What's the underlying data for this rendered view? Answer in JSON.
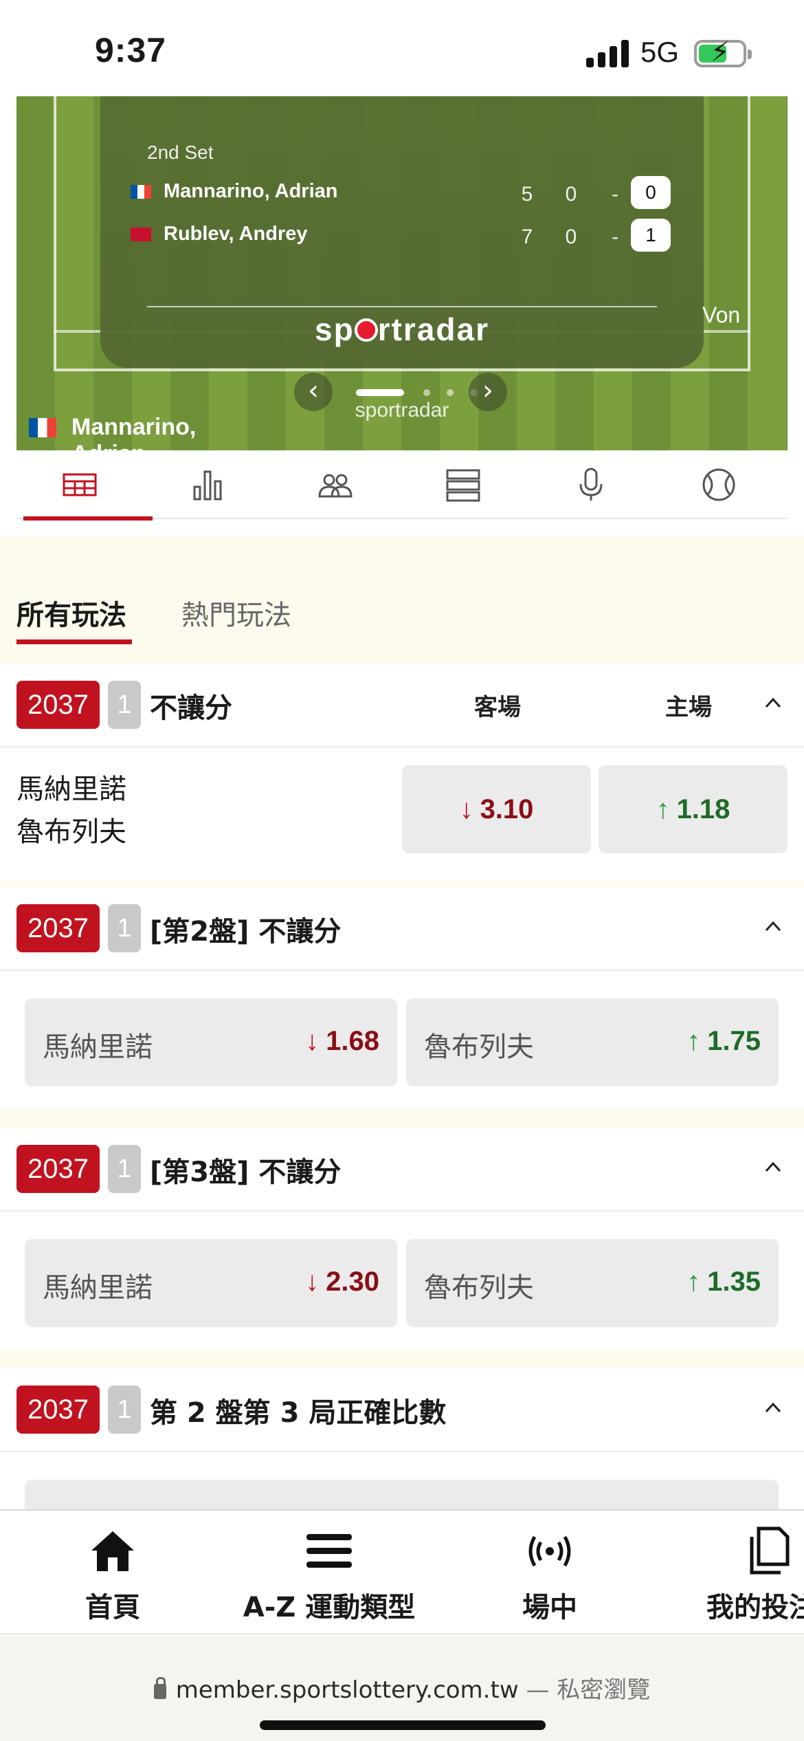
{
  "status_bar": {
    "time": "9:37",
    "network": "5G",
    "battery_icon": "battery-charging-icon",
    "signal_icon": "signal-bars-icon"
  },
  "widget": {
    "set_label": "2nd Set",
    "players": [
      {
        "name": "Mannarino, Adrian",
        "flag": "france-flag-icon",
        "games": "5",
        "col2": "0",
        "col3": "-",
        "points": "0"
      },
      {
        "name": "Rublev, Andrey",
        "flag": "russia-flag-icon",
        "games": "7",
        "col2": "0",
        "col3": "-",
        "points": "1"
      }
    ],
    "logo_prefix": "sp",
    "logo_suffix": "rtradar",
    "won_text": "Von",
    "pager": {
      "total": 4,
      "active": 1
    },
    "footer_player": "Mannarino, Adrian"
  },
  "icon_tabs": [
    {
      "name": "court-icon",
      "active": true
    },
    {
      "name": "stats-bars-icon",
      "active": false
    },
    {
      "name": "head-to-head-icon",
      "active": false
    },
    {
      "name": "list-icon",
      "active": false
    },
    {
      "name": "microphone-icon",
      "active": false
    },
    {
      "name": "tennis-ball-icon",
      "active": false
    }
  ],
  "market_tabs": {
    "all": "所有玩法",
    "hot": "熱門玩法"
  },
  "sections": [
    {
      "code": "2037",
      "num": "1",
      "title": "不讓分",
      "col_away": "客場",
      "col_home": "主場",
      "team_away": "馬納里諾",
      "team_home": "魯布列夫",
      "odd_away": "3.10",
      "odd_home": "1.18",
      "odd_away_arrow": "↓",
      "odd_home_arrow": "↑"
    },
    {
      "code": "2037",
      "num": "1",
      "title": "[第2盤] 不讓分",
      "left_label": "馬納里諾",
      "left_odd": "1.68",
      "left_arrow": "↓",
      "right_label": "魯布列夫",
      "right_odd": "1.75",
      "right_arrow": "↑"
    },
    {
      "code": "2037",
      "num": "1",
      "title": "[第3盤] 不讓分",
      "left_label": "馬納里諾",
      "left_odd": "2.30",
      "left_arrow": "↓",
      "right_label": "魯布列夫",
      "right_odd": "1.35",
      "right_arrow": "↑"
    },
    {
      "code": "2037",
      "num": "1",
      "title": "第 2 盤第 3 局正確比數"
    }
  ],
  "bottom_nav": [
    {
      "label": "首頁",
      "icon": "home-icon"
    },
    {
      "label": "A-Z 運動類型",
      "icon": "menu-icon"
    },
    {
      "label": "場中",
      "icon": "live-broadcast-icon"
    },
    {
      "label": "我的投注",
      "icon": "my-bets-icon"
    }
  ],
  "browser": {
    "url": "member.sportslottery.com.tw",
    "mode": " — 私密瀏覽"
  },
  "colors": {
    "brand_red": "#c1121f",
    "odds_down": "#8b0d16",
    "odds_up": "#1d6b27",
    "court_green": "#7da03f"
  }
}
